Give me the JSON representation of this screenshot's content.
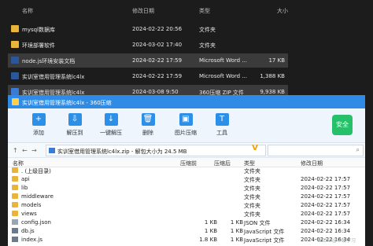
{
  "explorer": {
    "headers": {
      "name": "名称",
      "date": "修改日期",
      "type": "类型",
      "size": "大小"
    },
    "rows": [
      {
        "icon": "folder-icon",
        "name": "mysql数据库",
        "date": "2024-02-22 20:56",
        "type": "文件夹",
        "size": ""
      },
      {
        "icon": "folder-icon",
        "name": "环境部署软件",
        "date": "2024-03-02 17:40",
        "type": "文件夹",
        "size": ""
      },
      {
        "icon": "word-icon",
        "name": "node.js环境安装文档",
        "date": "2024-02-22 17:59",
        "type": "Microsoft Word ...",
        "size": "17 KB"
      },
      {
        "icon": "word-icon",
        "name": "实训室借用管理系统lc4lx",
        "date": "2024-02-22 17:59",
        "type": "Microsoft Word ...",
        "size": "1,388 KB"
      },
      {
        "icon": "zip-icon",
        "name": "实训室借用管理系统lc4lx",
        "date": "2024-03-08 9:50",
        "type": "360压缩 ZIP 文件",
        "size": "9,938 KB"
      }
    ]
  },
  "zip": {
    "title": "实训室借用管理系统lc4lx - 360压缩",
    "toolbar": [
      {
        "icon": "add-icon",
        "label": "添加",
        "glyph": "+"
      },
      {
        "icon": "extract-icon",
        "label": "解压到",
        "glyph": "⇩"
      },
      {
        "icon": "one-click-extract-icon",
        "label": "一键解压",
        "glyph": "↓"
      },
      {
        "icon": "delete-icon",
        "label": "删除",
        "glyph": "🗑"
      },
      {
        "icon": "image-tool-icon",
        "label": "图片压缩",
        "glyph": "▣"
      },
      {
        "icon": "tools-icon",
        "label": "工具",
        "glyph": "T"
      }
    ],
    "safe_label": "安全",
    "address": "实训室借用管理系统lc4lx.zip - 解包大小为 24.5 MB",
    "vmark": "V",
    "columns": {
      "name": "名称",
      "packed": "压缩前",
      "compressed": "压缩后",
      "type": "类型",
      "modified": "修改日期"
    },
    "files": [
      {
        "name": ". (上级目录)",
        "packed": "",
        "compressed": "",
        "type": "文件夹",
        "modified": ""
      },
      {
        "name": "api",
        "packed": "",
        "compressed": "",
        "type": "文件夹",
        "modified": "2024-02-22 17:57"
      },
      {
        "name": "lib",
        "packed": "",
        "compressed": "",
        "type": "文件夹",
        "modified": "2024-02-22 17:57"
      },
      {
        "name": "middleware",
        "packed": "",
        "compressed": "",
        "type": "文件夹",
        "modified": "2024-02-22 17:57"
      },
      {
        "name": "models",
        "packed": "",
        "compressed": "",
        "type": "文件夹",
        "modified": "2024-02-22 17:57"
      },
      {
        "name": "views",
        "packed": "",
        "compressed": "",
        "type": "文件夹",
        "modified": "2024-02-22 17:57"
      },
      {
        "name": "config.json",
        "packed": "1 KB",
        "compressed": "1 KB",
        "type": "JSON 文件",
        "modified": "2024-02-22 16:34"
      },
      {
        "name": "db.js",
        "packed": "1 KB",
        "compressed": "1 KB",
        "type": "JavaScript 文件",
        "modified": "2024-02-22 16:34"
      },
      {
        "name": "index.js",
        "packed": "1.8 KB",
        "compressed": "1 KB",
        "type": "JavaScript 文件",
        "modified": "2024-02-22 16:34"
      }
    ],
    "watermark": "CSDN @毕设学习"
  }
}
